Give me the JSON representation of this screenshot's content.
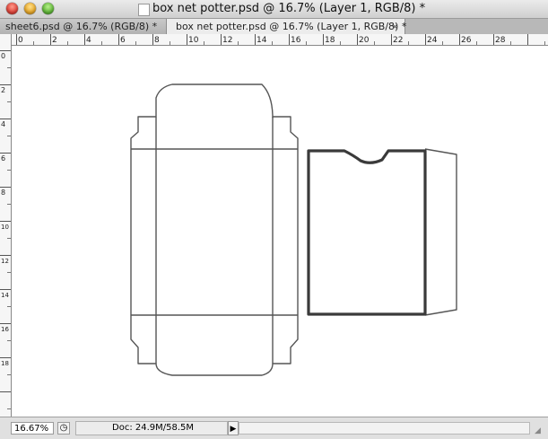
{
  "window": {
    "title": "box net potter.psd @ 16.7% (Layer 1, RGB/8) *"
  },
  "tabs": [
    {
      "label": "sheet6.psd @ 16.7% (RGB/8) *",
      "active": false
    },
    {
      "label": "box net potter.psd @ 16.7% (Layer 1, RGB/8) *",
      "active": true
    }
  ],
  "rulers": {
    "horizontal": [
      "0",
      "2",
      "4",
      "6",
      "8",
      "10",
      "12",
      "14",
      "16",
      "18",
      "20",
      "22",
      "24",
      "26",
      "28"
    ],
    "vertical": [
      "0",
      "2",
      "4",
      "6",
      "8",
      "10",
      "12",
      "14",
      "16",
      "18"
    ]
  },
  "status": {
    "zoom": "16.67%",
    "doc_info": "Doc: 24.9M/58.5M"
  },
  "colors": {
    "outline": "#555555",
    "selected_outline": "#3a3a3a"
  },
  "icons": {
    "tab_close": "close-icon",
    "status_menu": "triangle-right-icon"
  }
}
